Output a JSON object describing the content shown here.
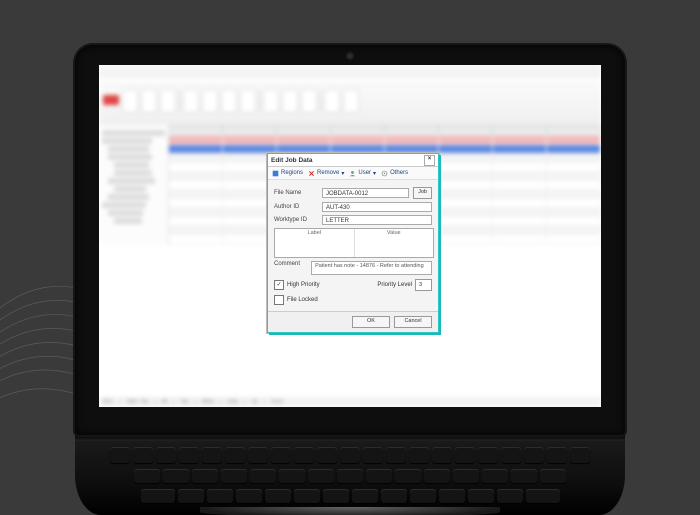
{
  "dialog": {
    "title": "Edit Job Data",
    "toolbar": {
      "regions": "Regions",
      "remove": "Remove",
      "user": "User",
      "others": "Others"
    },
    "fields": {
      "file_name_label": "File Name",
      "file_name_value": "JOBDATA-0012",
      "job_button": "Job",
      "author_id_label": "Author ID",
      "author_id_value": "AUT-430",
      "worktype_id_label": "Worktype ID",
      "worktype_id_value": "LETTER"
    },
    "list": {
      "col1": "Label",
      "col2": "Value"
    },
    "comment_label": "Comment",
    "comment_value": "Patient has note - 14876 - Refer to attending",
    "high_priority_label": "High Priority",
    "high_priority_checked": true,
    "priority_level_label": "Priority Level",
    "priority_level_value": "3",
    "file_locked_label": "File Locked",
    "file_locked_checked": false,
    "buttons": {
      "ok": "OK",
      "cancel": "Cancel"
    },
    "close": "×"
  },
  "statusbar": {
    "items": [
      "Rich",
      "Slide: Tab",
      "All",
      "Tab",
      "NRml",
      "Data",
      "Up",
      "Done"
    ]
  }
}
